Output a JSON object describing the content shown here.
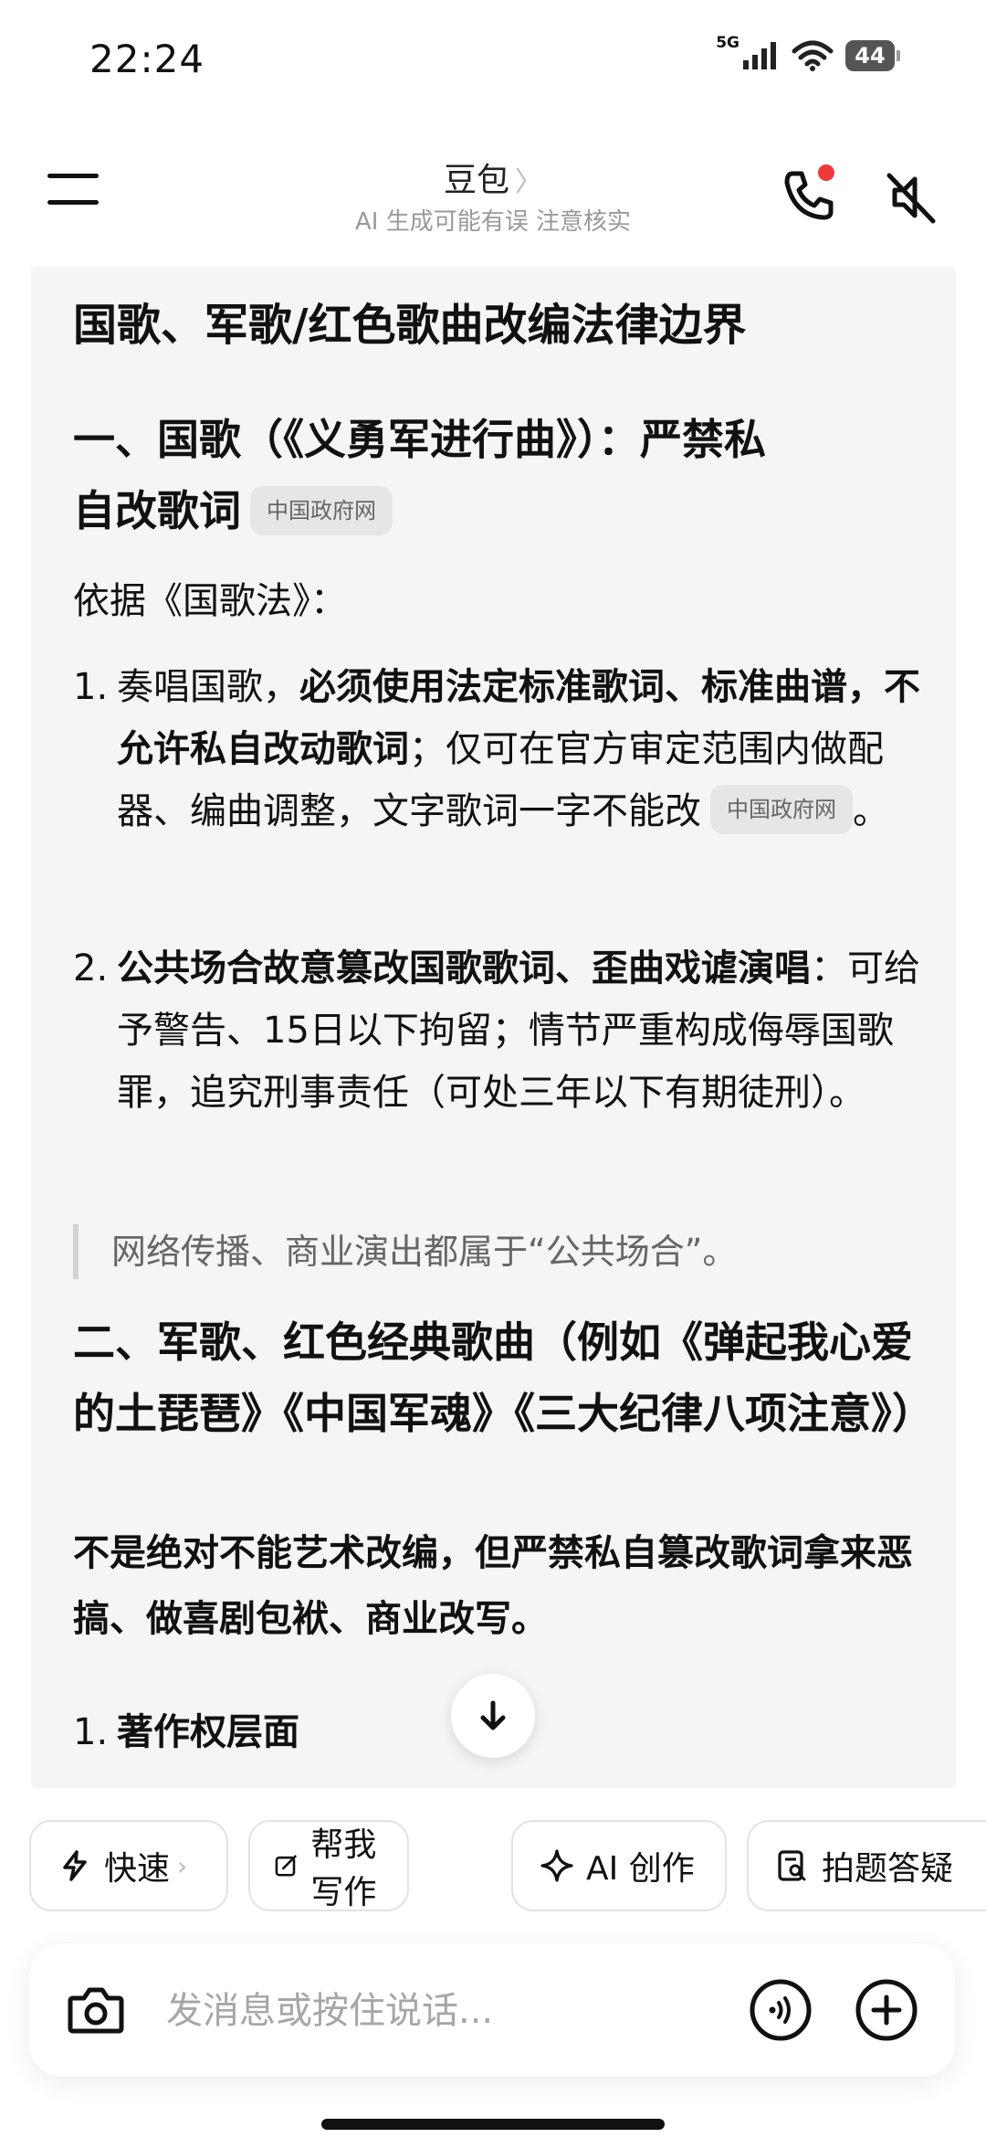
{
  "status_bar": {
    "time": "22:24",
    "network": "5G",
    "battery": "44"
  },
  "header": {
    "title": "豆包",
    "chevron": "〉",
    "subtitle": "AI 生成可能有误 注意核实",
    "call_badge_color": "#ee3a3a"
  },
  "content": {
    "title": "国歌、军歌/红色歌曲改编法律边界",
    "section1": {
      "heading_line1": "一、国歌（《义勇军进行曲》）：严禁私",
      "heading_line2": "自改歌词",
      "source_badge": "中国政府网",
      "intro": "依据《国歌法》：",
      "items": [
        {
          "num": "1.",
          "plain_start": "奏唱国歌，",
          "bold": "必须使用法定标准歌词、标准曲谱，不允许私自改动歌词",
          "plain_end": "；仅可在官方审定范围内做配器、编曲调整，文字歌词一字不能改",
          "source_badge": "中国政府网",
          "tail": "。"
        },
        {
          "num": "2.",
          "bold": "公共场合故意篡改国歌歌词、歪曲戏谑演唱",
          "plain_end": "：可给予警告、15日以下拘留；情节严重构成侮辱国歌罪，追究刑事责任（可处三年以下有期徒刑）。"
        }
      ],
      "quote": "网络传播、商业演出都属于“公共场合”。"
    },
    "section2": {
      "heading": "二、军歌、红色经典歌曲（例如《弹起我心爱的土琵琶》《中国军魂》《三大纪律八项注意》）",
      "summary": "不是绝对不能艺术改编，但严禁私自篡改歌词拿来恶搞、做喜剧包袱、商业改写。",
      "item1_num": "1.",
      "item1_heading": "著作权层面"
    }
  },
  "quick_actions": [
    {
      "label": "快速",
      "icon": "lightning-icon",
      "chevron": "›"
    },
    {
      "label": "帮我写作",
      "icon": "edit-icon"
    },
    {
      "label": "AI 创作",
      "icon": "sparkle-icon"
    },
    {
      "label": "拍题答疑",
      "icon": "scan-doc-icon"
    }
  ],
  "input": {
    "placeholder": "发消息或按住说话..."
  }
}
